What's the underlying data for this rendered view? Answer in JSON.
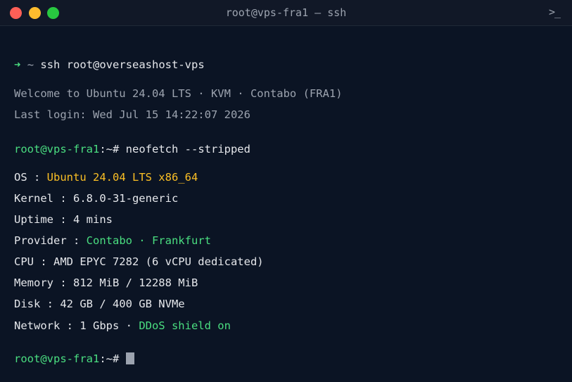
{
  "window": {
    "title": "root@vps-fra1 — ssh",
    "terminal_icon": "terminal-icon",
    "colors": {
      "background": "#0b1424",
      "titlebar": "#111827",
      "close": "#ff5f57",
      "minimize": "#febc2e",
      "maximize": "#28c840",
      "green": "#4ade80",
      "yellow": "#fbbf24",
      "dim": "#9ca3af"
    }
  },
  "terminal": {
    "ssh_line": {
      "arrow": "➜",
      "tilde": "~",
      "command": "ssh root@overseashost-vps"
    },
    "welcome": "Welcome to Ubuntu 24.04 LTS · KVM · Contabo (FRA1)",
    "last_login": "Last login: Wed Jul 15 14:22:07 2026",
    "prompt1": {
      "user_host": "root@vps-fra1",
      "suffix": ":~#",
      "command": "neofetch --stripped"
    },
    "info": {
      "os_key": "OS : ",
      "os_value": "Ubuntu 24.04 LTS x86_64",
      "kernel": "Kernel : 6.8.0-31-generic",
      "uptime": "Uptime : 4 mins",
      "provider_key": "Provider : ",
      "provider_value": "Contabo · Frankfurt",
      "cpu": "CPU : AMD EPYC 7282 (6 vCPU dedicated)",
      "memory": "Memory : 812 MiB / 12288 MiB",
      "disk": "Disk : 42 GB / 400 GB NVMe",
      "network_key": "Network : 1 Gbps · ",
      "network_value": "DDoS shield on"
    },
    "prompt2": {
      "user_host": "root@vps-fra1",
      "suffix": ":~#"
    }
  }
}
